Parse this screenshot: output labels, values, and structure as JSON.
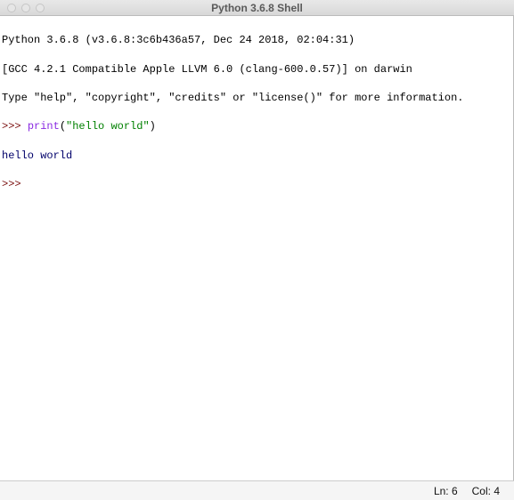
{
  "window": {
    "title": "Python 3.6.8 Shell"
  },
  "banner": {
    "line1": "Python 3.6.8 (v3.6.8:3c6b436a57, Dec 24 2018, 02:04:31)",
    "line2": "[GCC 4.2.1 Compatible Apple LLVM 6.0 (clang-600.0.57)] on darwin",
    "line3": "Type \"help\", \"copyright\", \"credits\" or \"license()\" for more information."
  },
  "session": {
    "prompt1": ">>> ",
    "prompt2": ">>> ",
    "func": "print",
    "lparen": "(",
    "arg_string": "\"hello world\"",
    "rparen": ")",
    "output1": "hello world"
  },
  "status": {
    "line_label": "Ln: 6",
    "col_label": "Col: 4"
  }
}
